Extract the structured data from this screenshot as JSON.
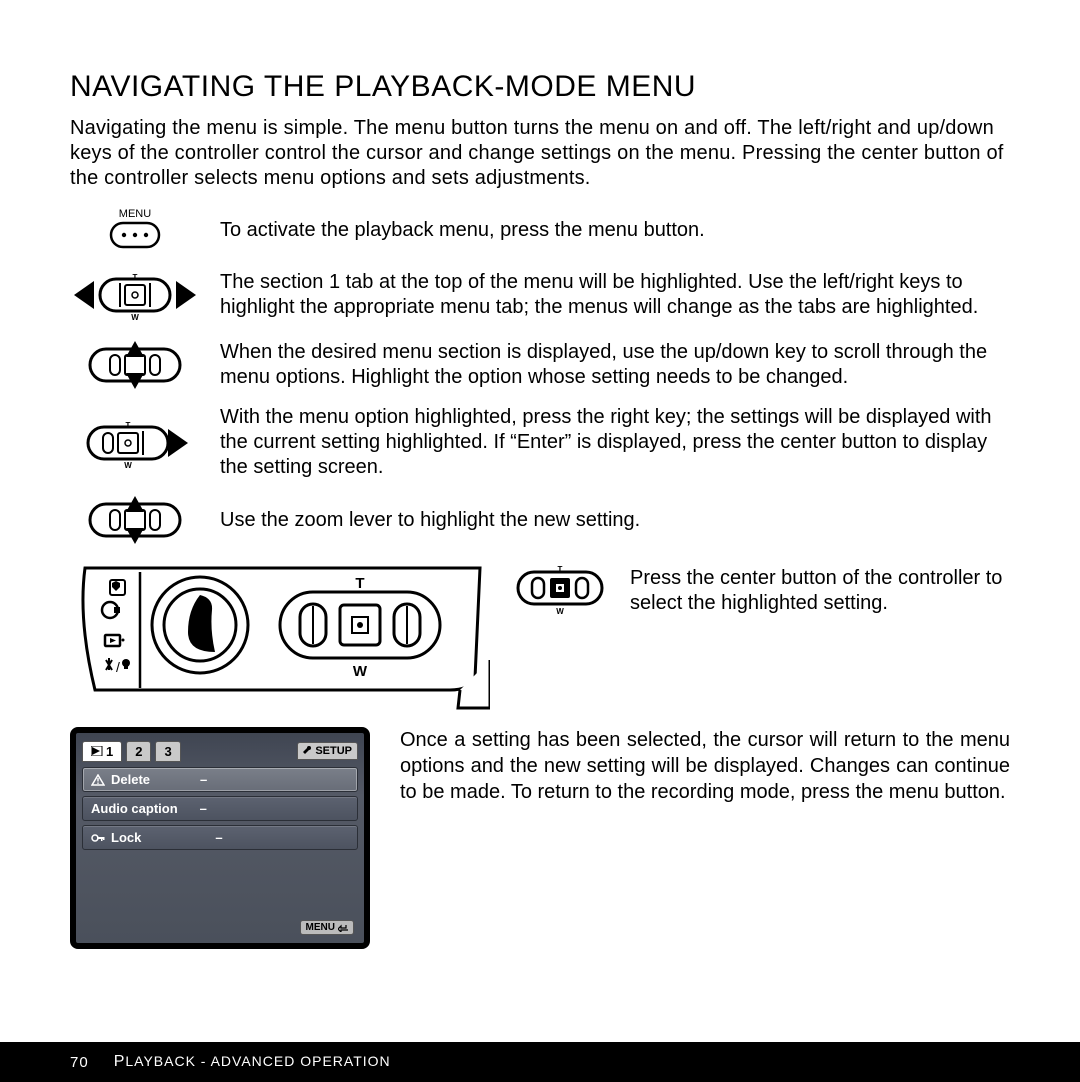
{
  "title": "NAVIGATING THE PLAYBACK-MODE MENU",
  "intro": "Navigating the menu is simple. The menu button turns the menu on and off. The left/right and up/down keys of the controller control the cursor and change settings on the menu. Pressing the center button of the controller selects menu options and sets adjustments.",
  "menu_label": "MENU",
  "steps": {
    "s1": "To activate the playback menu, press the menu button.",
    "s2": "The section 1 tab at the top of the menu will be highlighted. Use the left/right keys to highlight the appropriate menu tab; the menus will change as the tabs are highlighted.",
    "s3": "When the desired menu section is displayed, use the up/down key to scroll through the menu options. Highlight the option whose setting needs to be changed.",
    "s4": "With the menu option highlighted, press the right key; the settings will be displayed with the current setting highlighted. If “Enter” is displayed, press the center button to display the setting screen.",
    "s5": "Use the zoom lever to highlight the new setting.",
    "s6": "Press the center button of the controller to select the highlighted setting.",
    "s7": "Once a setting has been selected, the cursor will return to the menu options and the new setting will be displayed. Changes can continue to be made. To return to the recording mode, press the menu button."
  },
  "lcd": {
    "tabs": [
      "1",
      "2",
      "3"
    ],
    "setup_label": "SETUP",
    "items": [
      {
        "icon": "warning",
        "label": "Delete",
        "value": "–"
      },
      {
        "icon": "",
        "label": "Audio caption",
        "value": "–"
      },
      {
        "icon": "key",
        "label": "Lock",
        "value": "–"
      }
    ],
    "menu_badge": "MENU"
  },
  "footer": {
    "page": "70",
    "section_lead": "P",
    "section_rest": "LAYBACK - ADVANCED OPERATION"
  }
}
